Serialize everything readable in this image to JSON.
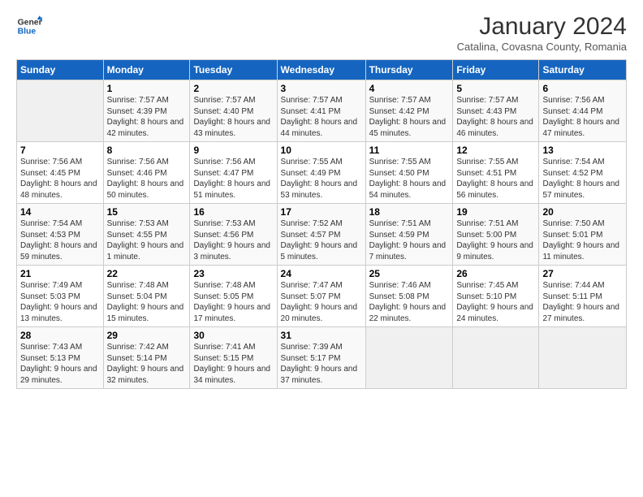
{
  "header": {
    "logo": {
      "general": "General",
      "blue": "Blue"
    },
    "title": "January 2024",
    "subtitle": "Catalina, Covasna County, Romania"
  },
  "weekdays": [
    "Sunday",
    "Monday",
    "Tuesday",
    "Wednesday",
    "Thursday",
    "Friday",
    "Saturday"
  ],
  "weeks": [
    [
      {
        "day": "",
        "sunrise": "",
        "sunset": "",
        "daylight": ""
      },
      {
        "day": "1",
        "sunrise": "Sunrise: 7:57 AM",
        "sunset": "Sunset: 4:39 PM",
        "daylight": "Daylight: 8 hours and 42 minutes."
      },
      {
        "day": "2",
        "sunrise": "Sunrise: 7:57 AM",
        "sunset": "Sunset: 4:40 PM",
        "daylight": "Daylight: 8 hours and 43 minutes."
      },
      {
        "day": "3",
        "sunrise": "Sunrise: 7:57 AM",
        "sunset": "Sunset: 4:41 PM",
        "daylight": "Daylight: 8 hours and 44 minutes."
      },
      {
        "day": "4",
        "sunrise": "Sunrise: 7:57 AM",
        "sunset": "Sunset: 4:42 PM",
        "daylight": "Daylight: 8 hours and 45 minutes."
      },
      {
        "day": "5",
        "sunrise": "Sunrise: 7:57 AM",
        "sunset": "Sunset: 4:43 PM",
        "daylight": "Daylight: 8 hours and 46 minutes."
      },
      {
        "day": "6",
        "sunrise": "Sunrise: 7:56 AM",
        "sunset": "Sunset: 4:44 PM",
        "daylight": "Daylight: 8 hours and 47 minutes."
      }
    ],
    [
      {
        "day": "7",
        "sunrise": "Sunrise: 7:56 AM",
        "sunset": "Sunset: 4:45 PM",
        "daylight": "Daylight: 8 hours and 48 minutes."
      },
      {
        "day": "8",
        "sunrise": "Sunrise: 7:56 AM",
        "sunset": "Sunset: 4:46 PM",
        "daylight": "Daylight: 8 hours and 50 minutes."
      },
      {
        "day": "9",
        "sunrise": "Sunrise: 7:56 AM",
        "sunset": "Sunset: 4:47 PM",
        "daylight": "Daylight: 8 hours and 51 minutes."
      },
      {
        "day": "10",
        "sunrise": "Sunrise: 7:55 AM",
        "sunset": "Sunset: 4:49 PM",
        "daylight": "Daylight: 8 hours and 53 minutes."
      },
      {
        "day": "11",
        "sunrise": "Sunrise: 7:55 AM",
        "sunset": "Sunset: 4:50 PM",
        "daylight": "Daylight: 8 hours and 54 minutes."
      },
      {
        "day": "12",
        "sunrise": "Sunrise: 7:55 AM",
        "sunset": "Sunset: 4:51 PM",
        "daylight": "Daylight: 8 hours and 56 minutes."
      },
      {
        "day": "13",
        "sunrise": "Sunrise: 7:54 AM",
        "sunset": "Sunset: 4:52 PM",
        "daylight": "Daylight: 8 hours and 57 minutes."
      }
    ],
    [
      {
        "day": "14",
        "sunrise": "Sunrise: 7:54 AM",
        "sunset": "Sunset: 4:53 PM",
        "daylight": "Daylight: 8 hours and 59 minutes."
      },
      {
        "day": "15",
        "sunrise": "Sunrise: 7:53 AM",
        "sunset": "Sunset: 4:55 PM",
        "daylight": "Daylight: 9 hours and 1 minute."
      },
      {
        "day": "16",
        "sunrise": "Sunrise: 7:53 AM",
        "sunset": "Sunset: 4:56 PM",
        "daylight": "Daylight: 9 hours and 3 minutes."
      },
      {
        "day": "17",
        "sunrise": "Sunrise: 7:52 AM",
        "sunset": "Sunset: 4:57 PM",
        "daylight": "Daylight: 9 hours and 5 minutes."
      },
      {
        "day": "18",
        "sunrise": "Sunrise: 7:51 AM",
        "sunset": "Sunset: 4:59 PM",
        "daylight": "Daylight: 9 hours and 7 minutes."
      },
      {
        "day": "19",
        "sunrise": "Sunrise: 7:51 AM",
        "sunset": "Sunset: 5:00 PM",
        "daylight": "Daylight: 9 hours and 9 minutes."
      },
      {
        "day": "20",
        "sunrise": "Sunrise: 7:50 AM",
        "sunset": "Sunset: 5:01 PM",
        "daylight": "Daylight: 9 hours and 11 minutes."
      }
    ],
    [
      {
        "day": "21",
        "sunrise": "Sunrise: 7:49 AM",
        "sunset": "Sunset: 5:03 PM",
        "daylight": "Daylight: 9 hours and 13 minutes."
      },
      {
        "day": "22",
        "sunrise": "Sunrise: 7:48 AM",
        "sunset": "Sunset: 5:04 PM",
        "daylight": "Daylight: 9 hours and 15 minutes."
      },
      {
        "day": "23",
        "sunrise": "Sunrise: 7:48 AM",
        "sunset": "Sunset: 5:05 PM",
        "daylight": "Daylight: 9 hours and 17 minutes."
      },
      {
        "day": "24",
        "sunrise": "Sunrise: 7:47 AM",
        "sunset": "Sunset: 5:07 PM",
        "daylight": "Daylight: 9 hours and 20 minutes."
      },
      {
        "day": "25",
        "sunrise": "Sunrise: 7:46 AM",
        "sunset": "Sunset: 5:08 PM",
        "daylight": "Daylight: 9 hours and 22 minutes."
      },
      {
        "day": "26",
        "sunrise": "Sunrise: 7:45 AM",
        "sunset": "Sunset: 5:10 PM",
        "daylight": "Daylight: 9 hours and 24 minutes."
      },
      {
        "day": "27",
        "sunrise": "Sunrise: 7:44 AM",
        "sunset": "Sunset: 5:11 PM",
        "daylight": "Daylight: 9 hours and 27 minutes."
      }
    ],
    [
      {
        "day": "28",
        "sunrise": "Sunrise: 7:43 AM",
        "sunset": "Sunset: 5:13 PM",
        "daylight": "Daylight: 9 hours and 29 minutes."
      },
      {
        "day": "29",
        "sunrise": "Sunrise: 7:42 AM",
        "sunset": "Sunset: 5:14 PM",
        "daylight": "Daylight: 9 hours and 32 minutes."
      },
      {
        "day": "30",
        "sunrise": "Sunrise: 7:41 AM",
        "sunset": "Sunset: 5:15 PM",
        "daylight": "Daylight: 9 hours and 34 minutes."
      },
      {
        "day": "31",
        "sunrise": "Sunrise: 7:39 AM",
        "sunset": "Sunset: 5:17 PM",
        "daylight": "Daylight: 9 hours and 37 minutes."
      },
      {
        "day": "",
        "sunrise": "",
        "sunset": "",
        "daylight": ""
      },
      {
        "day": "",
        "sunrise": "",
        "sunset": "",
        "daylight": ""
      },
      {
        "day": "",
        "sunrise": "",
        "sunset": "",
        "daylight": ""
      }
    ]
  ]
}
